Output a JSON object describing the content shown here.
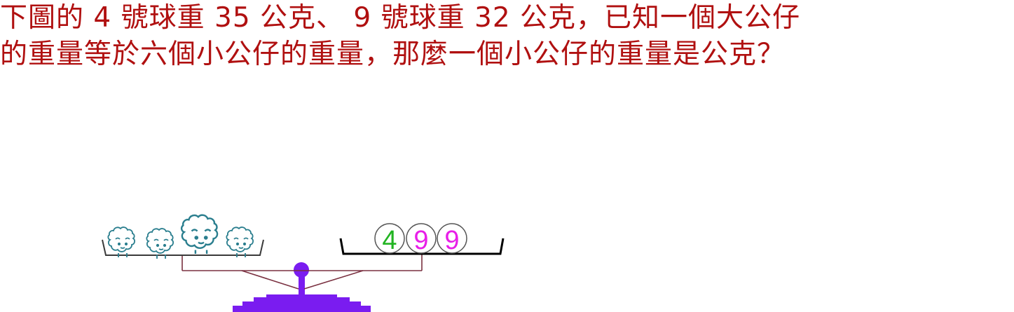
{
  "question": {
    "line1": "下圖的 4 號球重 35 公克、 9 號球重 32 公克，已知一個大公仔",
    "line2": "的重量等於六個小公仔的重量，那麼一個小公仔的重量是公克？"
  },
  "balls": [
    {
      "label": "4",
      "color": "#22b422"
    },
    {
      "label": "9",
      "color": "#e81ee8"
    },
    {
      "label": "9",
      "color": "#e81ee8"
    }
  ],
  "colors": {
    "question_text": "#b01010",
    "figurine_outline": "#2a7e8e",
    "beam": "#7a3040",
    "stand": "#7a1cf0",
    "pan_outline": "#000000"
  },
  "icons": {
    "small_figurine": "sheep-figurine-icon",
    "large_figurine": "sheep-figurine-large-icon"
  }
}
